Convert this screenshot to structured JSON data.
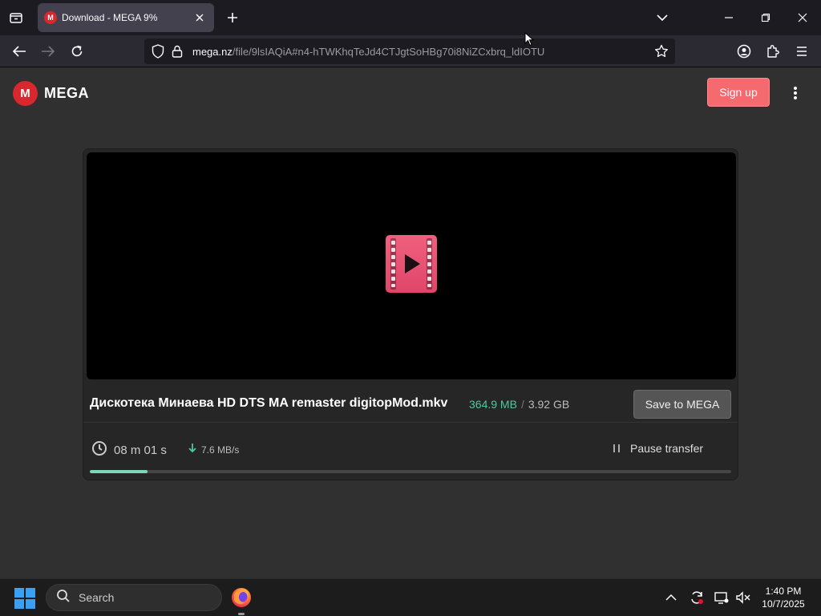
{
  "browser": {
    "tab": {
      "title": "Download - MEGA 9%",
      "favicon_letter": "M"
    },
    "url": {
      "host": "mega.nz",
      "path": "/file/9lsIAQiA#n4-hTWKhqTeJd4CTJgtSoHBg70i8NiZCxbrq_ldIOTU"
    }
  },
  "page": {
    "brand": {
      "logo_letter": "M",
      "name": "MEGA"
    },
    "signup_label": "Sign up",
    "file": {
      "name": "Дискотека Минаева HD DTS MA remaster digitopMod.mkv",
      "downloaded": "364.9 MB",
      "separator": "/",
      "total": "3.92 GB"
    },
    "save_label": "Save to MEGA",
    "time_remaining": "08 m  01 s",
    "speed": "7.6 MB/s",
    "pause_label": "Pause transfer",
    "progress_percent": 9,
    "accent_color": "#d9272e",
    "progress_color": "#7ed6b9"
  },
  "taskbar": {
    "search_placeholder": "Search",
    "time": "1:40 PM",
    "date": "10/7/2025"
  },
  "icons": [
    "tab-list-icon",
    "close-icon",
    "plus-icon",
    "chevron-down-icon",
    "minimize-icon",
    "restore-icon",
    "back-icon",
    "forward-icon",
    "reload-icon",
    "shield-icon",
    "lock-icon",
    "star-icon",
    "account-icon",
    "extensions-icon",
    "menu-icon",
    "kebab-icon",
    "video-file-icon",
    "clock-icon",
    "download-arrow-icon",
    "pause-icon",
    "windows-icon",
    "search-icon",
    "firefox-icon",
    "chevron-up-icon",
    "sync-icon",
    "display-icon",
    "speaker-muted-icon"
  ]
}
